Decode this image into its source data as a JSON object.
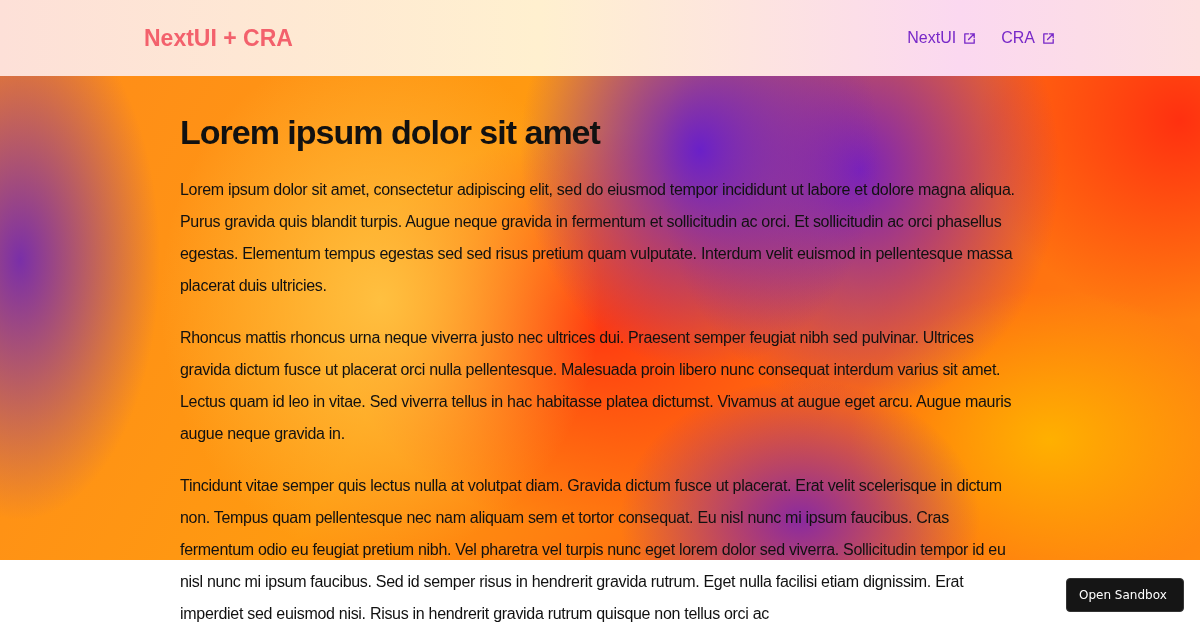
{
  "navbar": {
    "brand": "NextUI + CRA",
    "links": [
      {
        "label": "NextUI"
      },
      {
        "label": "CRA"
      }
    ]
  },
  "article": {
    "heading": "Lorem ipsum dolor sit amet",
    "paragraphs": [
      "Lorem ipsum dolor sit amet, consectetur adipiscing elit, sed do eiusmod tempor incididunt ut labore et dolore magna aliqua. Purus gravida quis blandit turpis. Augue neque gravida in fermentum et sollicitudin ac orci. Et sollicitudin ac orci phasellus egestas. Elementum tempus egestas sed sed risus pretium quam vulputate. Interdum velit euismod in pellentesque massa placerat duis ultricies.",
      "Rhoncus mattis rhoncus urna neque viverra justo nec ultrices dui. Praesent semper feugiat nibh sed pulvinar. Ultrices gravida dictum fusce ut placerat orci nulla pellentesque. Malesuada proin libero nunc consequat interdum varius sit amet. Lectus quam id leo in vitae. Sed viverra tellus in hac habitasse platea dictumst. Vivamus at augue eget arcu. Augue mauris augue neque gravida in.",
      "Tincidunt vitae semper quis lectus nulla at volutpat diam. Gravida dictum fusce ut placerat. Erat velit scelerisque in dictum non. Tempus quam pellentesque nec nam aliquam sem et tortor consequat. Eu nisl nunc mi ipsum faucibus. Cras fermentum odio eu feugiat pretium nibh. Vel pharetra vel turpis nunc eget lorem dolor sed viverra. Sollicitudin tempor id eu nisl nunc mi ipsum faucibus. Sed id semper risus in hendrerit gravida rutrum. Eget nulla facilisi etiam dignissim. Erat imperdiet sed euismod nisi. Risus in hendrerit gravida rutrum quisque non tellus orci ac"
    ]
  },
  "sandbox_button": {
    "label": "Open Sandbox"
  }
}
